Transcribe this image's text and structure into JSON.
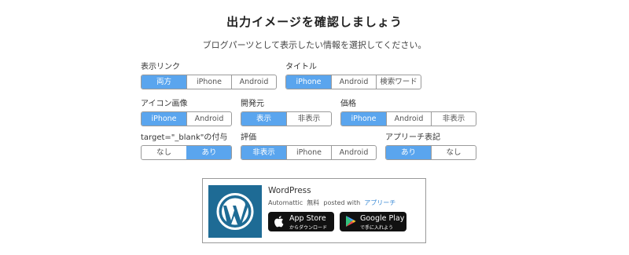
{
  "title": "出力イメージを確認しましょう",
  "subtitle": "ブログパーツとして表示したい情報を選択してください。",
  "options": {
    "display_link": {
      "label": "表示リンク",
      "choices": [
        "両方",
        "iPhone",
        "Android"
      ],
      "active": 0
    },
    "title_opt": {
      "label": "タイトル",
      "choices": [
        "iPhone",
        "Android",
        "検索ワード"
      ],
      "active": 0
    },
    "icon_image": {
      "label": "アイコン画像",
      "choices": [
        "iPhone",
        "Android"
      ],
      "active": 0
    },
    "developer": {
      "label": "開発元",
      "choices": [
        "表示",
        "非表示"
      ],
      "active": 0
    },
    "price": {
      "label": "価格",
      "choices": [
        "iPhone",
        "Android",
        "非表示"
      ],
      "active": 0
    },
    "target_blank": {
      "label": "target=\"_blank\"の付与",
      "choices": [
        "なし",
        "あり"
      ],
      "active": 1
    },
    "rating": {
      "label": "評価",
      "choices": [
        "非表示",
        "iPhone",
        "Android"
      ],
      "active": 0
    },
    "appreach_label": {
      "label": "アプリーチ表記",
      "choices": [
        "あり",
        "なし"
      ],
      "active": 0
    }
  },
  "preview": {
    "app_name": "WordPress",
    "developer": "Automattic",
    "price": "無料",
    "posted_with": "posted with",
    "posted_with_link": "アプリーチ",
    "logo_icon": "wordpress-logo",
    "app_store": {
      "line1": "App Store",
      "line2": "からダウンロード"
    },
    "google_play": {
      "line1": "Google Play",
      "line2": "で手に入れよう"
    }
  },
  "colors": {
    "active": "#5aa5ee",
    "border": "#9a9a9a",
    "logo_bg": "#1e6b95",
    "link": "#3c8bd6"
  }
}
